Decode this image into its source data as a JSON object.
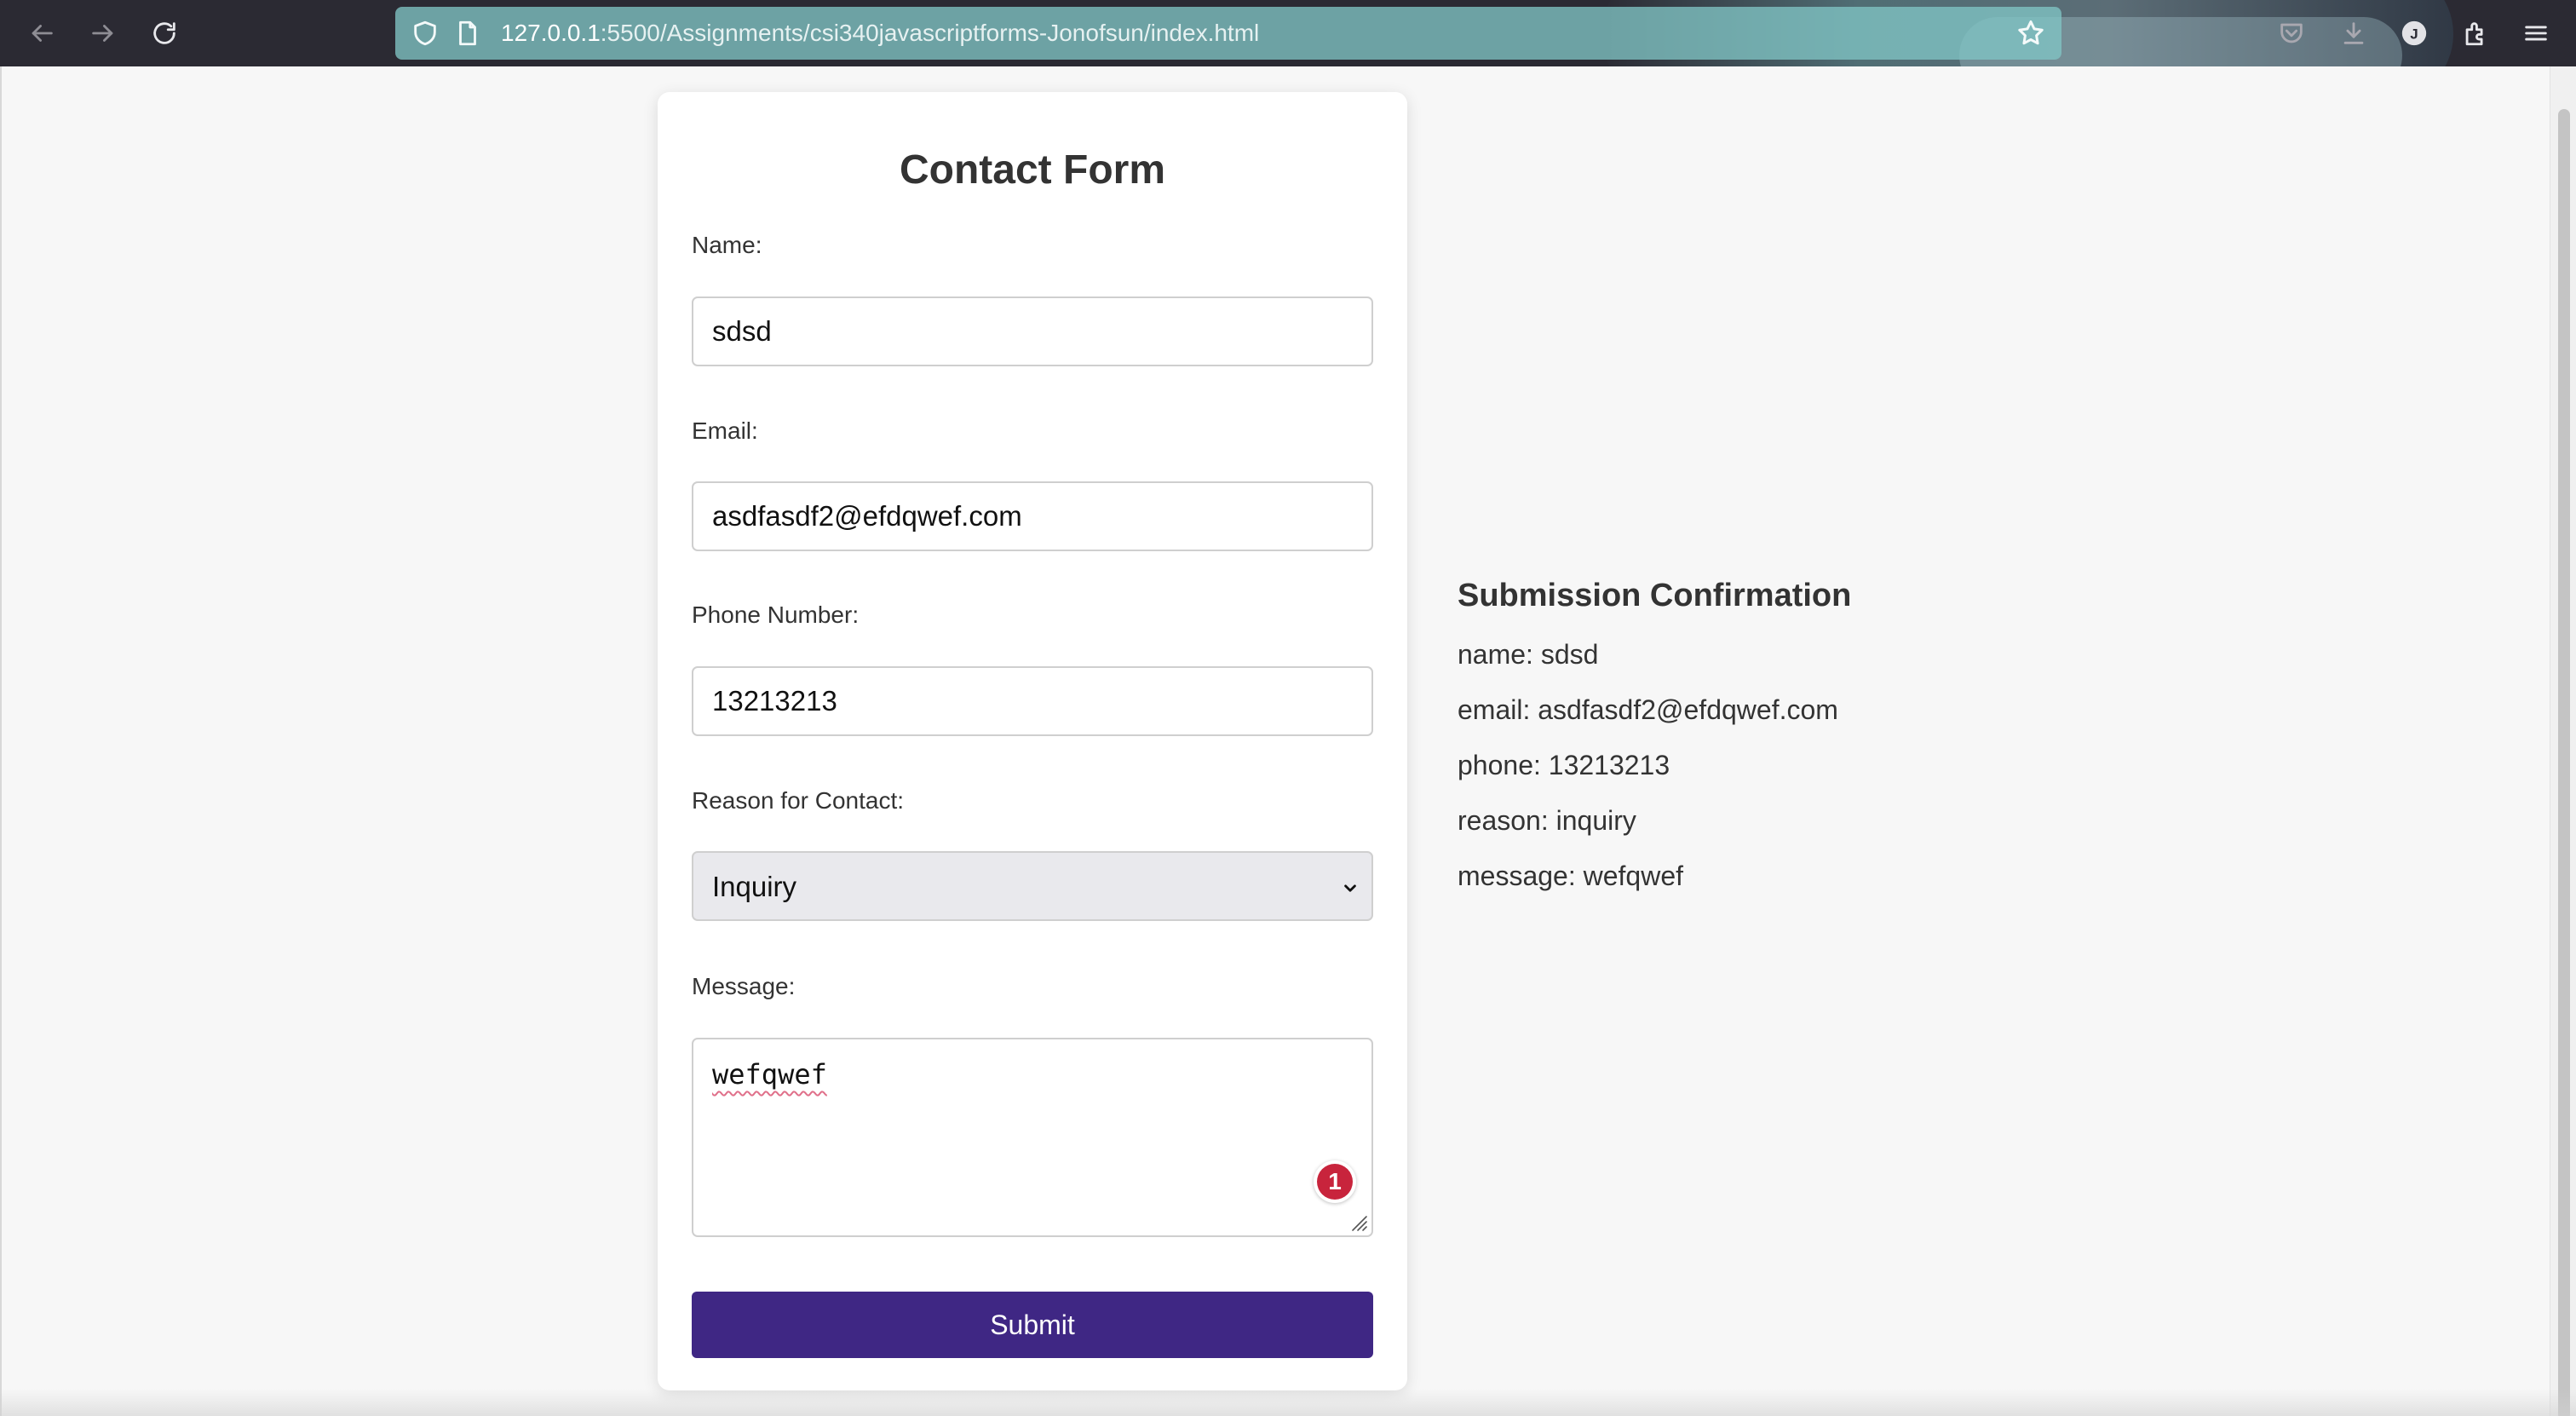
{
  "browser": {
    "url_host": "127.0.0.1",
    "url_rest": ":5500/Assignments/csi340javascriptforms-Jonofsun/index.html",
    "profile_initial": "J",
    "icons": [
      "back-arrow-icon",
      "forward-arrow-icon",
      "reload-icon",
      "shield-icon",
      "page-icon",
      "star-icon",
      "pocket-icon",
      "download-icon",
      "account-icon",
      "extensions-icon",
      "menu-icon"
    ]
  },
  "form": {
    "title": "Contact Form",
    "name": {
      "label": "Name:",
      "value": "sdsd"
    },
    "email": {
      "label": "Email:",
      "value": "asdfasdf2@efdqwef.com"
    },
    "phone": {
      "label": "Phone Number:",
      "value": "13213213"
    },
    "reason": {
      "label": "Reason for Contact:",
      "selected": "Inquiry"
    },
    "message": {
      "label": "Message:",
      "value": "wefqwef",
      "badge_count": "1"
    },
    "submit_label": "Submit"
  },
  "confirmation": {
    "title": "Submission Confirmation",
    "lines": [
      "name: sdsd",
      "email: asdfasdf2@efdqwef.com",
      "phone: 13213213",
      "reason: inquiry",
      "message: wefqwef"
    ]
  },
  "colors": {
    "toolbar": "#2b2a33",
    "urlbar": "#80c4c4",
    "page_bg": "#f7f7f7",
    "submit": "#3f2784",
    "badge": "#c8243c"
  }
}
